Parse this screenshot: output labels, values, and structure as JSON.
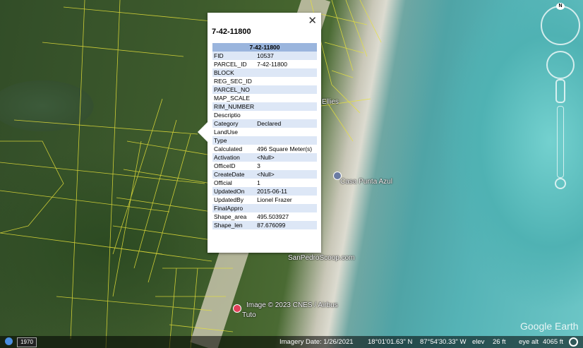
{
  "map": {
    "labels": {
      "ellies": "Ellies",
      "casa": "Casa Punta Azul",
      "sanpedro": "SanPedroScoop.com",
      "copyright": "Image © 2023 CNES / Airbus",
      "tuto": "Tuto"
    }
  },
  "popup": {
    "title": "7-42-11800",
    "table_header": "7-42-11800",
    "close_label": "✕",
    "rows": [
      {
        "key": "FID",
        "value": "10537"
      },
      {
        "key": "PARCEL_ID",
        "value": "7-42-11800"
      },
      {
        "key": "BLOCK",
        "value": ""
      },
      {
        "key": "REG_SEC_ID",
        "value": ""
      },
      {
        "key": "PARCEL_NO",
        "value": ""
      },
      {
        "key": "MAP_SCALE",
        "value": ""
      },
      {
        "key": "RIM_NUMBER",
        "value": ""
      },
      {
        "key": "Descriptio",
        "value": ""
      },
      {
        "key": "Category",
        "value": "Declared"
      },
      {
        "key": "LandUse",
        "value": ""
      },
      {
        "key": "Type",
        "value": ""
      },
      {
        "key": "Calculated",
        "value": "496 Square Meter(s)"
      },
      {
        "key": "Activation",
        "value": "<Null>"
      },
      {
        "key": "OfficeID",
        "value": "3"
      },
      {
        "key": "CreateDate",
        "value": "<Null>"
      },
      {
        "key": "Official",
        "value": "1"
      },
      {
        "key": "UpdatedOn",
        "value": "2015-06-11"
      },
      {
        "key": "UpdatedBy",
        "value": "Lionel Frazer"
      },
      {
        "key": "FinalAppro",
        "value": ""
      },
      {
        "key": "Shape_area",
        "value": "495.503927"
      },
      {
        "key": "Shape_len",
        "value": "87.676099"
      }
    ]
  },
  "nav": {
    "north_label": "N"
  },
  "status": {
    "year": "1970",
    "imagery_date": "Imagery Date: 1/26/2021",
    "lat": "18°01'01.63\" N",
    "lon": "87°54'30.33\" W",
    "elev_label": "elev",
    "elev_value": "26 ft",
    "eye_label": "eye alt",
    "eye_value": "4065 ft"
  },
  "logo": "Google Earth"
}
